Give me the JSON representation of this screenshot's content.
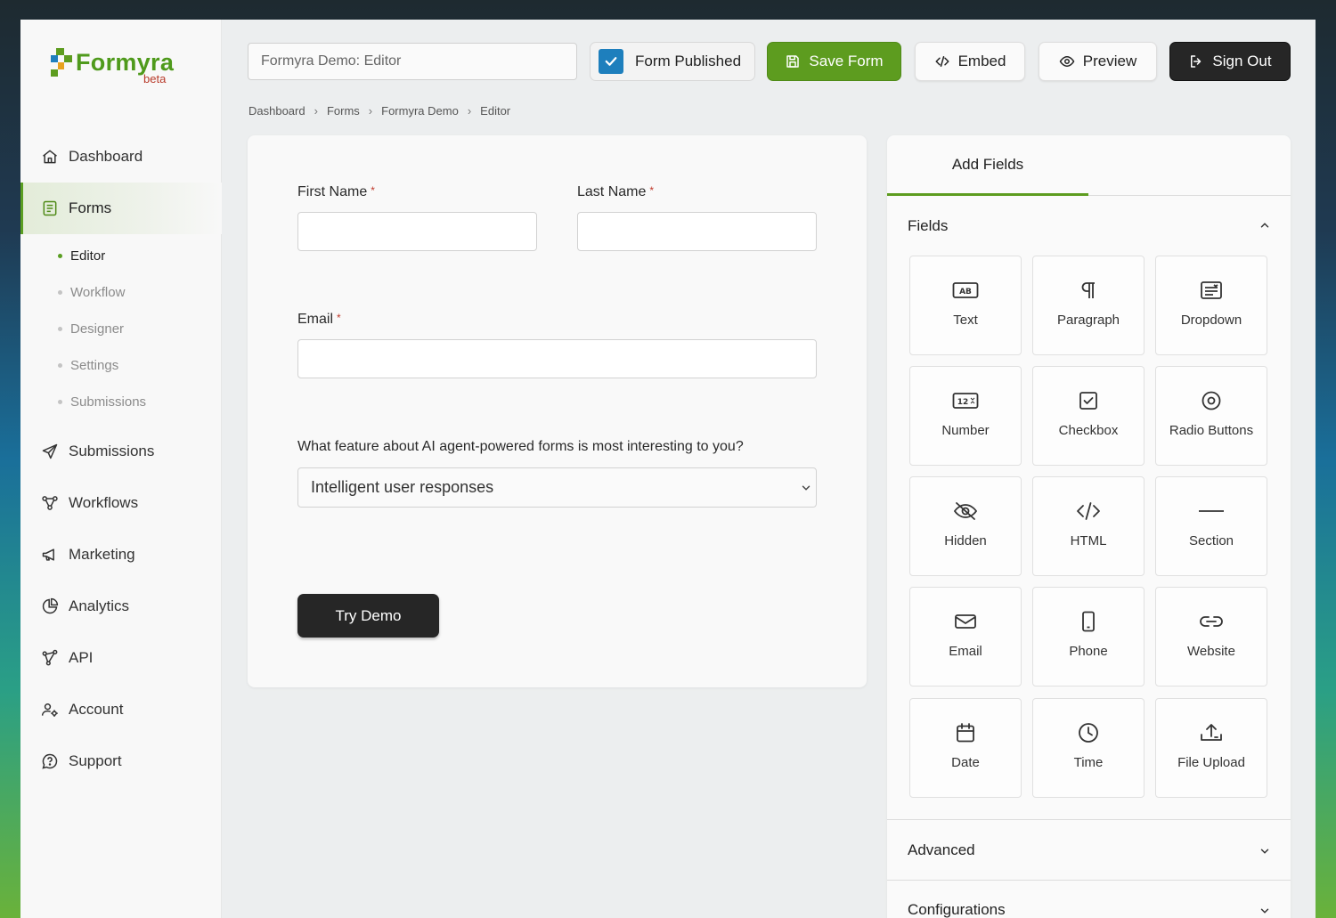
{
  "app": {
    "logo_text": "Formyra",
    "logo_badge": "beta"
  },
  "sidebar": {
    "items": [
      {
        "label": "Dashboard",
        "icon": "home-icon"
      },
      {
        "label": "Forms",
        "icon": "form-icon",
        "active": true
      },
      {
        "label": "Submissions",
        "icon": "send-icon"
      },
      {
        "label": "Workflows",
        "icon": "workflow-icon"
      },
      {
        "label": "Marketing",
        "icon": "megaphone-icon"
      },
      {
        "label": "Analytics",
        "icon": "pie-chart-icon"
      },
      {
        "label": "API",
        "icon": "api-icon"
      },
      {
        "label": "Account",
        "icon": "user-settings-icon"
      },
      {
        "label": "Support",
        "icon": "help-chat-icon"
      }
    ],
    "sub_items": [
      "Editor",
      "Workflow",
      "Designer",
      "Settings",
      "Submissions"
    ],
    "active_sub": "Editor"
  },
  "toolbar": {
    "title_value": "Formyra Demo: Editor",
    "published_label": "Form Published",
    "published_checked": true,
    "save_label": "Save Form",
    "embed_label": "Embed",
    "preview_label": "Preview",
    "signout_label": "Sign Out"
  },
  "breadcrumb": [
    "Dashboard",
    "Forms",
    "Formyra Demo",
    "Editor"
  ],
  "form": {
    "first_name_label": "First Name",
    "last_name_label": "Last Name",
    "email_label": "Email",
    "required_mark": "*",
    "question_label": "What feature about AI agent-powered forms is most interesting to you?",
    "question_selected": "Intelligent user responses",
    "submit_label": "Try Demo"
  },
  "panel": {
    "tab_label": "Add Fields",
    "fields_section": "Fields",
    "advanced_section": "Advanced",
    "config_section": "Configurations",
    "fields": [
      {
        "label": "Text",
        "icon": "text-ab-icon"
      },
      {
        "label": "Paragraph",
        "icon": "paragraph-icon"
      },
      {
        "label": "Dropdown",
        "icon": "dropdown-icon"
      },
      {
        "label": "Number",
        "icon": "number-icon"
      },
      {
        "label": "Checkbox",
        "icon": "checkbox-icon"
      },
      {
        "label": "Radio Buttons",
        "icon": "radio-icon"
      },
      {
        "label": "Hidden",
        "icon": "eye-off-icon"
      },
      {
        "label": "HTML",
        "icon": "code-icon"
      },
      {
        "label": "Section",
        "icon": "section-line-icon"
      },
      {
        "label": "Email",
        "icon": "envelope-icon"
      },
      {
        "label": "Phone",
        "icon": "phone-icon"
      },
      {
        "label": "Website",
        "icon": "link-icon"
      },
      {
        "label": "Date",
        "icon": "calendar-icon"
      },
      {
        "label": "Time",
        "icon": "clock-icon"
      },
      {
        "label": "File Upload",
        "icon": "upload-icon"
      }
    ]
  },
  "colors": {
    "brand_green": "#5d9c1f",
    "checkbox_blue": "#1e7fbd",
    "dark_button": "#262626",
    "required_red": "#c0392b"
  }
}
